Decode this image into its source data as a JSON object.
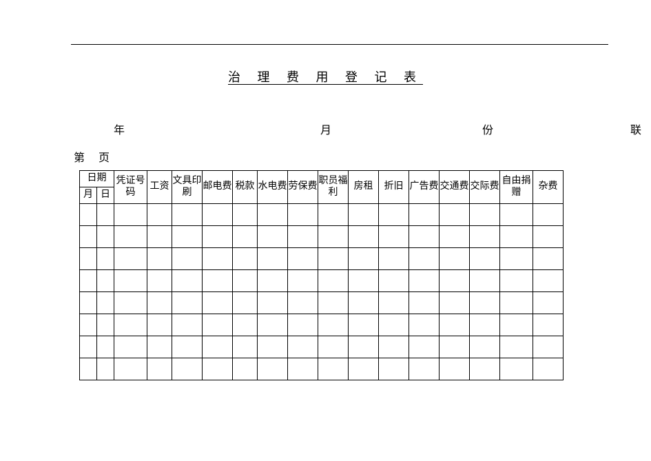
{
  "title": "治 理 费 用 登 记 表",
  "meta": {
    "year": "年",
    "month": "月",
    "fen": "份",
    "lian": "联"
  },
  "page": {
    "di": "第",
    "ye": "页"
  },
  "headers": {
    "date": "日期",
    "month_col": "月",
    "day_col": "日",
    "voucher_no": "凭证号码",
    "salary": "工资",
    "stationery_printing": "文具印刷",
    "postage": "邮电费",
    "tax": "税款",
    "utilities": "水电费",
    "labor_insurance": "劳保费",
    "staff_welfare": "职员福利",
    "rent": "房租",
    "depreciation": "折旧",
    "advertising": "广告费",
    "transport": "交通费",
    "entertainment": "交际费",
    "donation": "自由捐赠",
    "misc": "杂费"
  },
  "chart_data": {
    "type": "table",
    "title": "治理费用登记表",
    "columns": [
      "月",
      "日",
      "凭证号码",
      "工资",
      "文具印刷",
      "邮电费",
      "税款",
      "水电费",
      "劳保费",
      "职员福利",
      "房租",
      "折旧",
      "广告费",
      "交通费",
      "交际费",
      "自由捐赠",
      "杂费"
    ],
    "rows": [
      [
        "",
        "",
        "",
        "",
        "",
        "",
        "",
        "",
        "",
        "",
        "",
        "",
        "",
        "",
        "",
        "",
        ""
      ],
      [
        "",
        "",
        "",
        "",
        "",
        "",
        "",
        "",
        "",
        "",
        "",
        "",
        "",
        "",
        "",
        "",
        ""
      ],
      [
        "",
        "",
        "",
        "",
        "",
        "",
        "",
        "",
        "",
        "",
        "",
        "",
        "",
        "",
        "",
        "",
        ""
      ],
      [
        "",
        "",
        "",
        "",
        "",
        "",
        "",
        "",
        "",
        "",
        "",
        "",
        "",
        "",
        "",
        "",
        ""
      ],
      [
        "",
        "",
        "",
        "",
        "",
        "",
        "",
        "",
        "",
        "",
        "",
        "",
        "",
        "",
        "",
        "",
        ""
      ],
      [
        "",
        "",
        "",
        "",
        "",
        "",
        "",
        "",
        "",
        "",
        "",
        "",
        "",
        "",
        "",
        "",
        ""
      ],
      [
        "",
        "",
        "",
        "",
        "",
        "",
        "",
        "",
        "",
        "",
        "",
        "",
        "",
        "",
        "",
        "",
        ""
      ],
      [
        "",
        "",
        "",
        "",
        "",
        "",
        "",
        "",
        "",
        "",
        "",
        "",
        "",
        "",
        "",
        "",
        ""
      ]
    ]
  }
}
